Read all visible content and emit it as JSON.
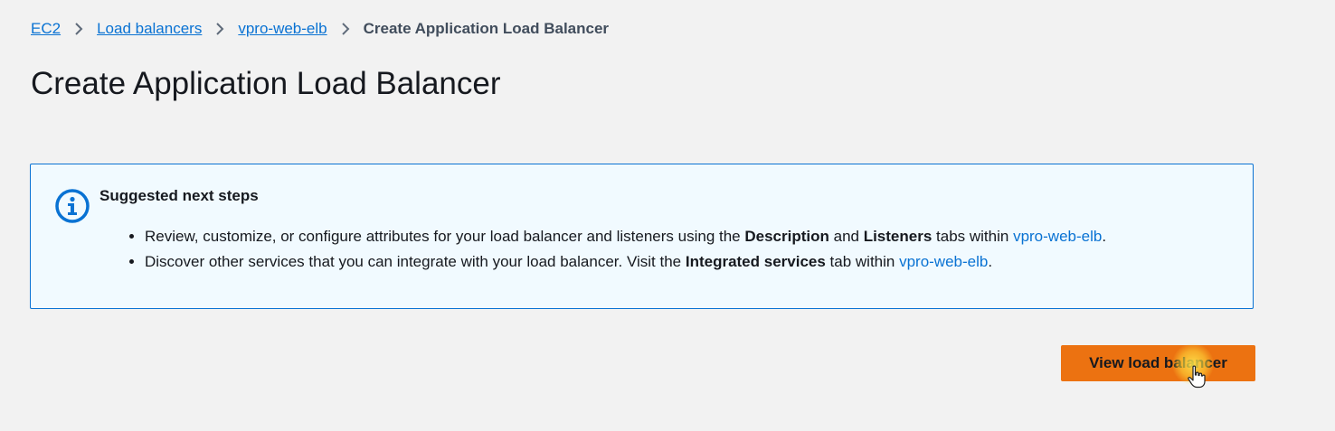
{
  "breadcrumb": {
    "items": [
      {
        "label": "EC2"
      },
      {
        "label": "Load balancers"
      },
      {
        "label": "vpro-web-elb"
      }
    ],
    "current": "Create Application Load Balancer"
  },
  "page": {
    "title": "Create Application Load Balancer"
  },
  "alert": {
    "icon": "info-icon",
    "title": "Suggested next steps",
    "items": [
      {
        "text_a": "Review, customize, or configure attributes for your load balancer and listeners using the ",
        "bold_a": "Description",
        "text_b": " and ",
        "bold_b": "Listeners",
        "text_c": " tabs within ",
        "link": "vpro-web-elb",
        "end": "."
      },
      {
        "text_a": "Discover other services that you can integrate with your load balancer. Visit the ",
        "bold_a": "Integrated services",
        "text_b": " tab within ",
        "link": "vpro-web-elb",
        "end": "."
      }
    ]
  },
  "actions": {
    "view_label": "View load balancer"
  },
  "colors": {
    "background": "#f2f2f2",
    "link": "#0972d3",
    "alert_border": "#0972d3",
    "alert_bg": "#f1faff",
    "primary_button": "#ec7211"
  }
}
